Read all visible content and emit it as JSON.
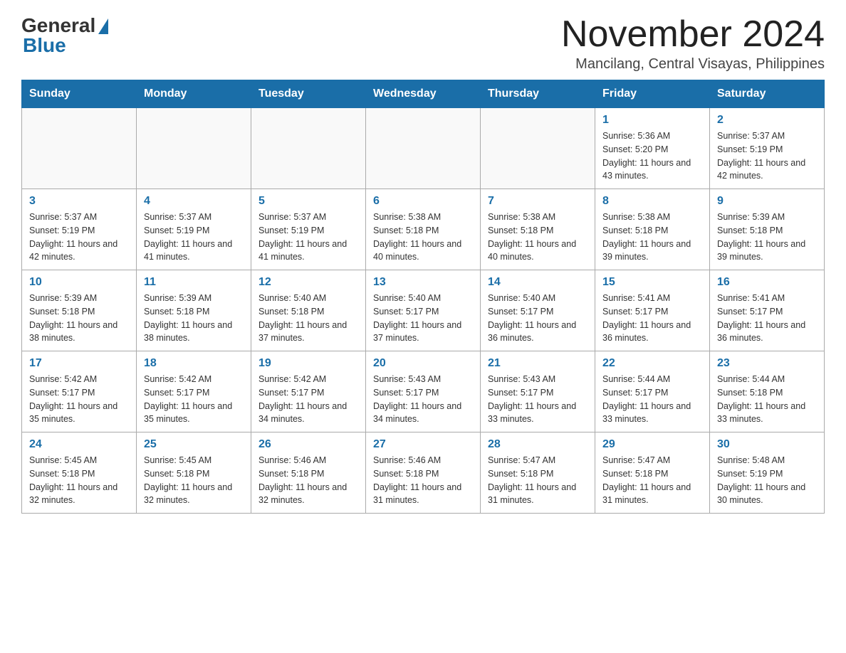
{
  "logo": {
    "general": "General",
    "blue": "Blue"
  },
  "header": {
    "month_title": "November 2024",
    "location": "Mancilang, Central Visayas, Philippines"
  },
  "days_of_week": [
    "Sunday",
    "Monday",
    "Tuesday",
    "Wednesday",
    "Thursday",
    "Friday",
    "Saturday"
  ],
  "weeks": [
    [
      {
        "day": "",
        "info": ""
      },
      {
        "day": "",
        "info": ""
      },
      {
        "day": "",
        "info": ""
      },
      {
        "day": "",
        "info": ""
      },
      {
        "day": "",
        "info": ""
      },
      {
        "day": "1",
        "info": "Sunrise: 5:36 AM\nSunset: 5:20 PM\nDaylight: 11 hours and 43 minutes."
      },
      {
        "day": "2",
        "info": "Sunrise: 5:37 AM\nSunset: 5:19 PM\nDaylight: 11 hours and 42 minutes."
      }
    ],
    [
      {
        "day": "3",
        "info": "Sunrise: 5:37 AM\nSunset: 5:19 PM\nDaylight: 11 hours and 42 minutes."
      },
      {
        "day": "4",
        "info": "Sunrise: 5:37 AM\nSunset: 5:19 PM\nDaylight: 11 hours and 41 minutes."
      },
      {
        "day": "5",
        "info": "Sunrise: 5:37 AM\nSunset: 5:19 PM\nDaylight: 11 hours and 41 minutes."
      },
      {
        "day": "6",
        "info": "Sunrise: 5:38 AM\nSunset: 5:18 PM\nDaylight: 11 hours and 40 minutes."
      },
      {
        "day": "7",
        "info": "Sunrise: 5:38 AM\nSunset: 5:18 PM\nDaylight: 11 hours and 40 minutes."
      },
      {
        "day": "8",
        "info": "Sunrise: 5:38 AM\nSunset: 5:18 PM\nDaylight: 11 hours and 39 minutes."
      },
      {
        "day": "9",
        "info": "Sunrise: 5:39 AM\nSunset: 5:18 PM\nDaylight: 11 hours and 39 minutes."
      }
    ],
    [
      {
        "day": "10",
        "info": "Sunrise: 5:39 AM\nSunset: 5:18 PM\nDaylight: 11 hours and 38 minutes."
      },
      {
        "day": "11",
        "info": "Sunrise: 5:39 AM\nSunset: 5:18 PM\nDaylight: 11 hours and 38 minutes."
      },
      {
        "day": "12",
        "info": "Sunrise: 5:40 AM\nSunset: 5:18 PM\nDaylight: 11 hours and 37 minutes."
      },
      {
        "day": "13",
        "info": "Sunrise: 5:40 AM\nSunset: 5:17 PM\nDaylight: 11 hours and 37 minutes."
      },
      {
        "day": "14",
        "info": "Sunrise: 5:40 AM\nSunset: 5:17 PM\nDaylight: 11 hours and 36 minutes."
      },
      {
        "day": "15",
        "info": "Sunrise: 5:41 AM\nSunset: 5:17 PM\nDaylight: 11 hours and 36 minutes."
      },
      {
        "day": "16",
        "info": "Sunrise: 5:41 AM\nSunset: 5:17 PM\nDaylight: 11 hours and 36 minutes."
      }
    ],
    [
      {
        "day": "17",
        "info": "Sunrise: 5:42 AM\nSunset: 5:17 PM\nDaylight: 11 hours and 35 minutes."
      },
      {
        "day": "18",
        "info": "Sunrise: 5:42 AM\nSunset: 5:17 PM\nDaylight: 11 hours and 35 minutes."
      },
      {
        "day": "19",
        "info": "Sunrise: 5:42 AM\nSunset: 5:17 PM\nDaylight: 11 hours and 34 minutes."
      },
      {
        "day": "20",
        "info": "Sunrise: 5:43 AM\nSunset: 5:17 PM\nDaylight: 11 hours and 34 minutes."
      },
      {
        "day": "21",
        "info": "Sunrise: 5:43 AM\nSunset: 5:17 PM\nDaylight: 11 hours and 33 minutes."
      },
      {
        "day": "22",
        "info": "Sunrise: 5:44 AM\nSunset: 5:17 PM\nDaylight: 11 hours and 33 minutes."
      },
      {
        "day": "23",
        "info": "Sunrise: 5:44 AM\nSunset: 5:18 PM\nDaylight: 11 hours and 33 minutes."
      }
    ],
    [
      {
        "day": "24",
        "info": "Sunrise: 5:45 AM\nSunset: 5:18 PM\nDaylight: 11 hours and 32 minutes."
      },
      {
        "day": "25",
        "info": "Sunrise: 5:45 AM\nSunset: 5:18 PM\nDaylight: 11 hours and 32 minutes."
      },
      {
        "day": "26",
        "info": "Sunrise: 5:46 AM\nSunset: 5:18 PM\nDaylight: 11 hours and 32 minutes."
      },
      {
        "day": "27",
        "info": "Sunrise: 5:46 AM\nSunset: 5:18 PM\nDaylight: 11 hours and 31 minutes."
      },
      {
        "day": "28",
        "info": "Sunrise: 5:47 AM\nSunset: 5:18 PM\nDaylight: 11 hours and 31 minutes."
      },
      {
        "day": "29",
        "info": "Sunrise: 5:47 AM\nSunset: 5:18 PM\nDaylight: 11 hours and 31 minutes."
      },
      {
        "day": "30",
        "info": "Sunrise: 5:48 AM\nSunset: 5:19 PM\nDaylight: 11 hours and 30 minutes."
      }
    ]
  ]
}
